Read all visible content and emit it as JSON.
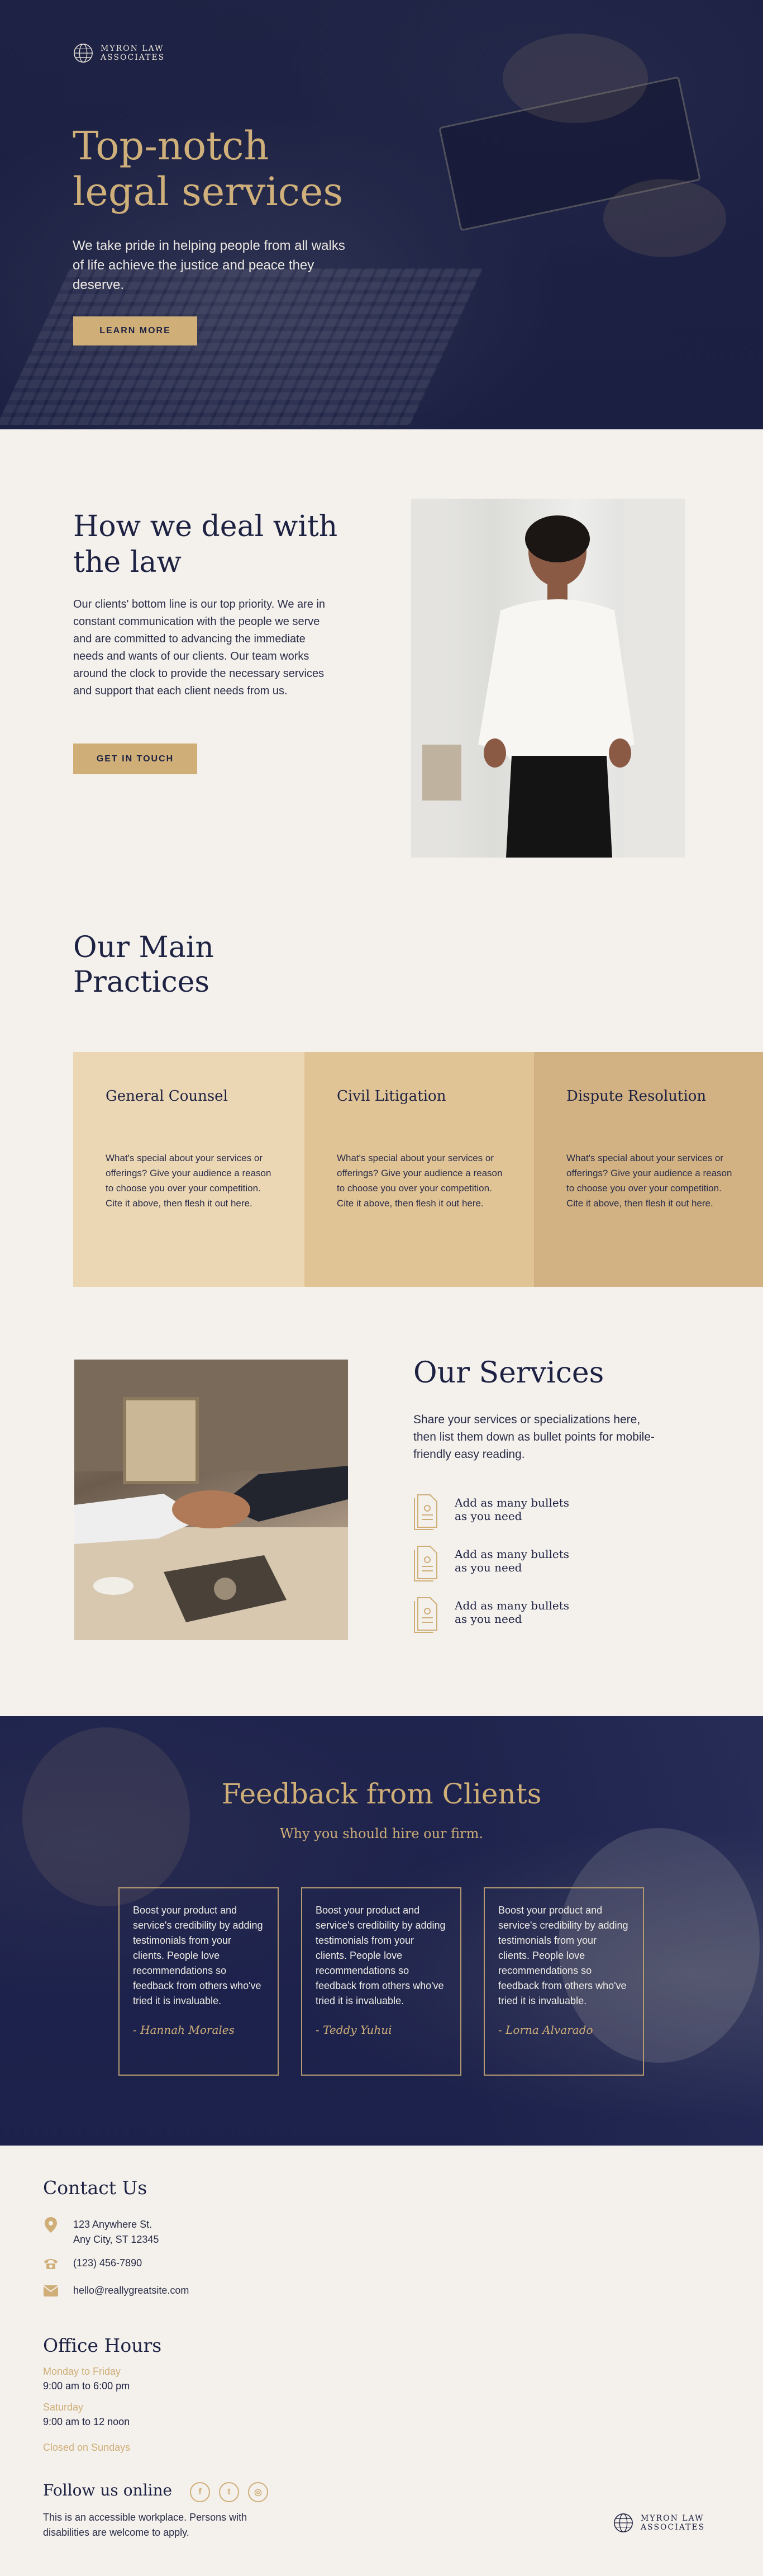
{
  "brand": {
    "name_line1": "MYRON LAW",
    "name_line2": "ASSOCIATES"
  },
  "hero": {
    "title": "Top-notch legal services",
    "subtitle": "We take pride in helping people from all walks of life achieve the justice and peace they deserve.",
    "cta": "LEARN MORE"
  },
  "approach": {
    "title": "How we deal with the law",
    "body": "Our clients' bottom line is our top priority. We are in constant communication with the people we serve and are committed to advancing the immediate needs and wants of our clients. Our team works around the clock to provide the necessary services and support that each client needs from us.",
    "cta": "GET IN TOUCH"
  },
  "practices": {
    "title": "Our Main Practices",
    "items": [
      {
        "name": "General Counsel",
        "desc": "What's special about your services or offerings? Give your audience a reason to choose you over your competition. Cite it above, then flesh it out here.",
        "color": "#ecd7b5"
      },
      {
        "name": "Civil Litigation",
        "desc": "What's special about your services or offerings? Give your audience a reason to choose you over your competition. Cite it above, then flesh it out here.",
        "color": "#e1c496"
      },
      {
        "name": "Dispute Resolution",
        "desc": "What's special about your services or offerings? Give your audience a reason to choose you over your competition. Cite it above, then flesh it out here.",
        "color": "#d2b283"
      }
    ]
  },
  "services": {
    "title": "Our Services",
    "intro": "Share your services or specializations here, then list them down as bullet points for mobile-friendly easy reading.",
    "bullets": [
      {
        "line1": "Add as many bullets",
        "line2": "as you need",
        "icon": "document-icon"
      },
      {
        "line1": "Add as many bullets",
        "line2": "as you need",
        "icon": "document-icon"
      },
      {
        "line1": "Add as many bullets",
        "line2": "as you need",
        "icon": "document-icon"
      }
    ]
  },
  "feedback": {
    "title": "Feedback from Clients",
    "subtitle": "Why you should hire our firm.",
    "testimonials": [
      {
        "text": "Boost your product and service's credibility by adding testimonials from your clients. People love recommendations so feedback from others who've tried it is invaluable.",
        "author": "- Hannah Morales"
      },
      {
        "text": "Boost your product and service's credibility by adding testimonials from your clients. People love recommendations so feedback from others who've tried it is invaluable.",
        "author": "- Teddy Yuhui"
      },
      {
        "text": "Boost your product and service's credibility by adding testimonials from your clients. People love recommendations so feedback from others who've tried it is invaluable.",
        "author": "- Lorna Alvarado"
      }
    ]
  },
  "contact": {
    "title": "Contact Us",
    "address_line1": "123 Anywhere St.",
    "address_line2": "Any City, ST 12345",
    "phone": "(123) 456-7890",
    "email": "hello@reallygreatsite.com"
  },
  "hours": {
    "title": "Office Hours",
    "weekday_label": "Monday to Friday",
    "weekday_hours": "9:00 am to 6:00 pm",
    "saturday_label": "Saturday",
    "saturday_hours": "9:00 am to 12 noon",
    "sunday": "Closed on Sundays"
  },
  "social": {
    "title": "Follow us online",
    "icons": [
      "facebook-icon",
      "twitter-icon",
      "instagram-icon"
    ],
    "facebook_glyph": "f",
    "twitter_glyph": "t",
    "instagram_glyph": "◎"
  },
  "accessibility": "This is an accessible workplace. Persons with disabilities are welcome to apply.",
  "colors": {
    "navy": "#1d2142",
    "gold": "#cfae78",
    "cream": "#f4f1ec"
  }
}
